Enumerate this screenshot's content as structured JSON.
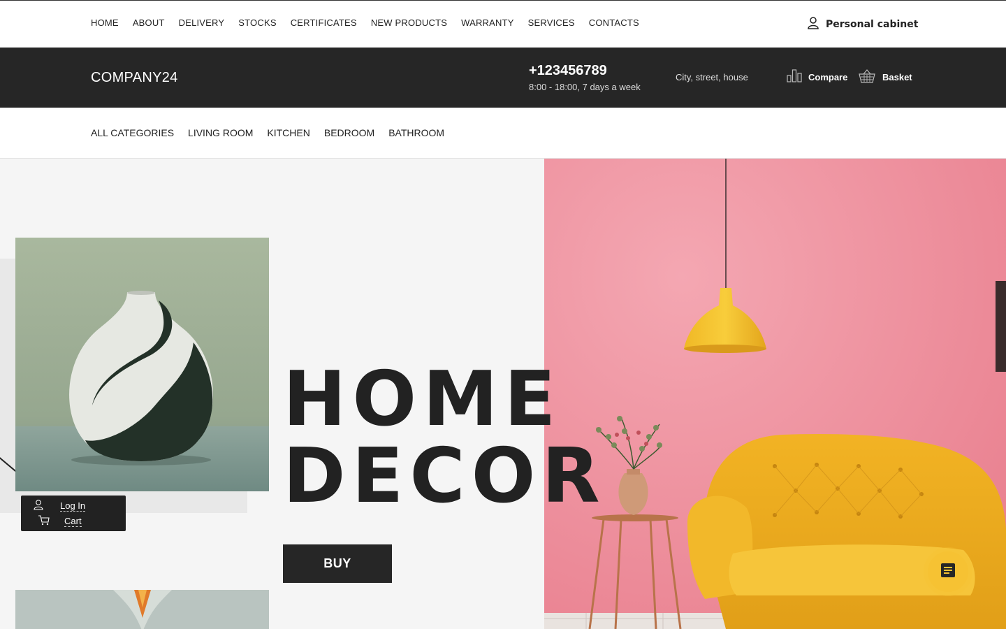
{
  "topnav": {
    "items": [
      "HOME",
      "ABOUT",
      "DELIVERY",
      "STOCKS",
      "CERTIFICATES",
      "NEW PRODUCTS",
      "WARRANTY",
      "SERVICES",
      "CONTACTS"
    ],
    "cabinet_label": "Personal cabinet"
  },
  "header": {
    "logo": "COMPANY24",
    "phone": "+123456789",
    "hours": "8:00 - 18:00, 7 days a week",
    "address": "City, street, house",
    "compare_label": "Compare",
    "basket_label": "Basket"
  },
  "categories": [
    "ALL CATEGORIES",
    "LIVING ROOM",
    "KITCHEN",
    "BEDROOM",
    "BATHROOM"
  ],
  "hero": {
    "line1": "HOME",
    "line2": "DECOR",
    "buy_label": "BUY"
  },
  "popover": {
    "login_label": "Log In",
    "cart_label": "Cart"
  },
  "icons": {
    "cabinet": "user-icon",
    "compare": "bar-chart-icon",
    "basket": "basket-icon",
    "login": "user-icon",
    "cart": "cart-icon",
    "fab": "document-icon"
  },
  "colors": {
    "dark": "#262626",
    "accent": "#f6c233",
    "wall": "#ee8e9e"
  }
}
